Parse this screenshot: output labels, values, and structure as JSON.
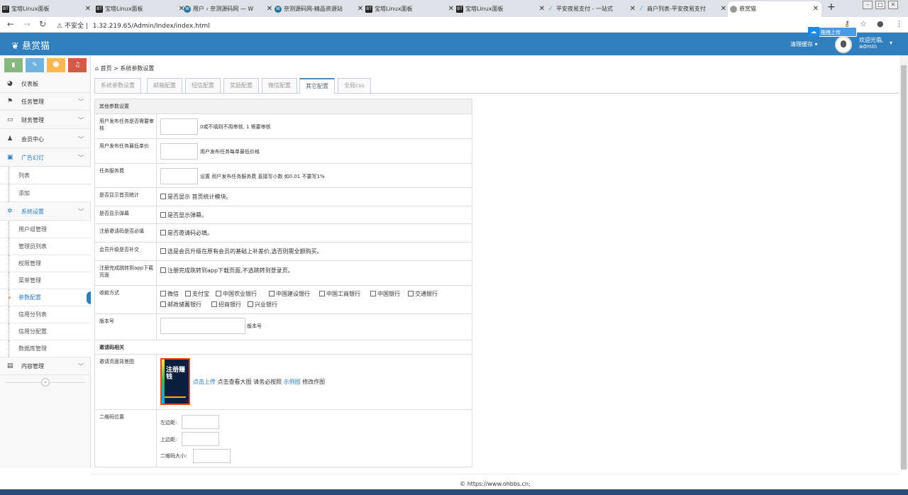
{
  "browser": {
    "tabs": [
      {
        "label": "宝塔Linux面板",
        "fav": "BT"
      },
      {
        "label": "宝塔Linux面板",
        "fav": "BT"
      },
      {
        "label": "用户 ‹ 奈测源码网 — W",
        "fav": "W"
      },
      {
        "label": "奈测源码网-精品资源站",
        "fav": "W"
      },
      {
        "label": "宝塔Linux面板",
        "fav": "BT"
      },
      {
        "label": "宝塔Linux面板",
        "fav": "BT"
      },
      {
        "label": "平安夜易支付 - 一站式",
        "fav": "link"
      },
      {
        "label": "商户列表-平安夜易支付",
        "fav": "link"
      },
      {
        "label": "悬赏猫",
        "fav": "globe"
      }
    ],
    "insecure_label": "不安全",
    "url": "1.32.219.65/Admin/Index/index.html"
  },
  "app": {
    "logo": "悬赏猫",
    "clear_cache": "清理缓存",
    "welcome": "欢迎光临,",
    "username": "admin",
    "upload_badge": "拖拽上传"
  },
  "sidebar": {
    "menu": [
      {
        "label": "仪表板",
        "icon": "dashboard-icon"
      },
      {
        "label": "任务管理",
        "icon": "flag-icon"
      },
      {
        "label": "财务管理",
        "icon": "wallet-icon"
      },
      {
        "label": "会员中心",
        "icon": "user-icon"
      },
      {
        "label": "广告幻灯",
        "icon": "picture-icon"
      },
      {
        "label": "系统设置",
        "icon": "gear-icon"
      },
      {
        "label": "内容管理",
        "icon": "book-icon"
      }
    ],
    "ad_sub": [
      "列表",
      "添加"
    ],
    "sys_sub": [
      "用户组管理",
      "管理员列表",
      "权限管理",
      "菜单管理",
      "参数配置",
      "信用分列表",
      "信用分配置",
      "数据库管理"
    ]
  },
  "breadcrumb": {
    "home": "首页",
    "sep": ">",
    "current": "系统参数设置"
  },
  "tabs": [
    "系统参数设置",
    "邮箱配置",
    "短信配置",
    "奖励配置",
    "微信配置",
    "其它配置",
    "全局css"
  ],
  "form": {
    "section1": "其他参数设置",
    "f1_label": "用户发布任务是否需要审核",
    "f1_hint": "0或不填则不用审核, 1 需要审核",
    "f2_label": "用户发布任务最低单价",
    "f2_hint": "用户发布任务每单最低价格",
    "f3_label": "任务服务费",
    "f3_hint": "设置 用户发布任务服务费 直接写小数 如0.01 不要写1%",
    "f4_label": "是否显示首页统计",
    "f4_check": "是否显示 首页统计模块。",
    "f5_label": "是否显示弹幕",
    "f5_check": "是否显示弹幕。",
    "f6_label": "注册邀请码是否必填",
    "f6_check": "是否邀请码必填。",
    "f7_label": "会员升级是否补交",
    "f7_check": "选是会员升级在原有会员的基础上补差价,选否则需全额购买。",
    "f8_label": "注册完成跳转到app下载页面",
    "f8_check": "注册完成跳转到app下载页面,不选跳转到登录页。",
    "f9_label": "收款方式",
    "payments": [
      "微信",
      "支付宝",
      "中国农业银行",
      "中国建设银行",
      "中国工商银行",
      "中国银行",
      "交通银行",
      "邮政储蓄银行",
      "招商银行",
      "兴业银行"
    ],
    "f10_label": "版本号",
    "f10_hint": "版本号",
    "section2": "邀请码相关",
    "f11_label": "邀请页面背景图",
    "poster_text": "注册赚钱",
    "upload_link": "点击上传",
    "view_text": "点击查看大图 请务必按照",
    "example_link": "示例图",
    "modify_text": "修改作图",
    "f12_label": "二维码位置",
    "left_margin": "左边距:",
    "top_margin": "上边距:",
    "qr_size": "二维码大小:"
  },
  "footer": {
    "text": "© https://www.ohbbs.cn;"
  }
}
